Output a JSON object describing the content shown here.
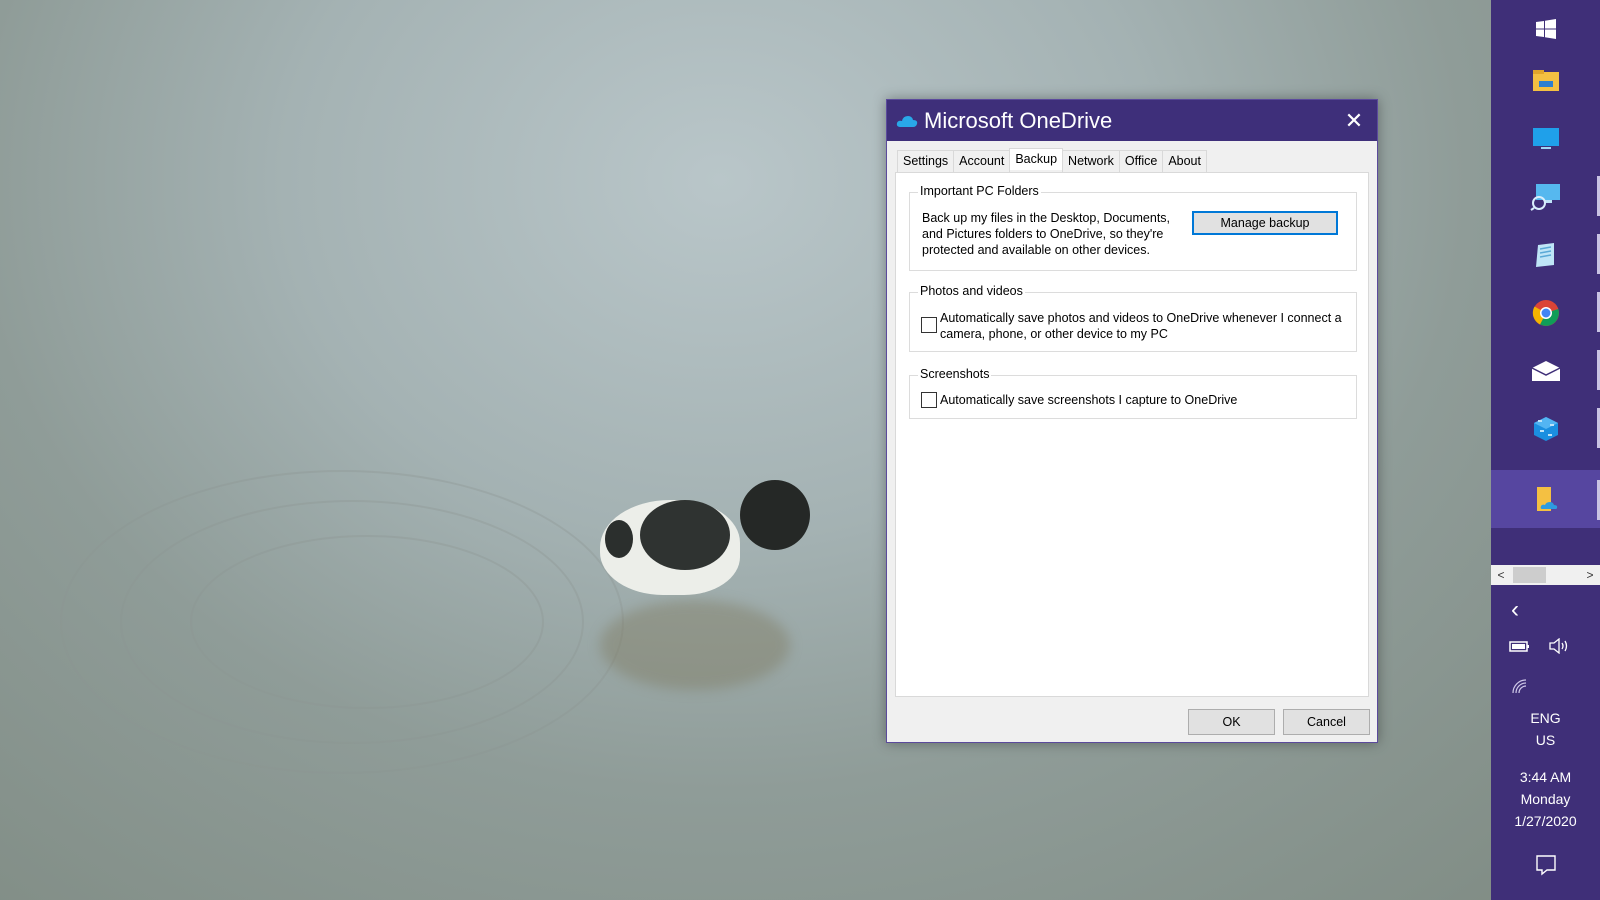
{
  "dialog": {
    "title": "Microsoft OneDrive",
    "close_glyph": "✕",
    "tabs": [
      {
        "label": "Settings"
      },
      {
        "label": "Account"
      },
      {
        "label": "Backup",
        "active": true
      },
      {
        "label": "Network"
      },
      {
        "label": "Office"
      },
      {
        "label": "About"
      }
    ],
    "important_folders": {
      "title": "Important PC Folders",
      "description": "Back up my files in the Desktop, Documents, and Pictures folders to OneDrive, so they're protected and available on other devices.",
      "button_label": "Manage backup"
    },
    "photos_videos": {
      "title": "Photos and videos",
      "checkbox_label": "Automatically save photos and videos to OneDrive whenever I connect a camera, phone, or other device to my PC",
      "checked": false
    },
    "screenshots": {
      "title": "Screenshots",
      "checkbox_label": "Automatically save screenshots I capture to OneDrive",
      "checked": false
    },
    "ok_label": "OK",
    "cancel_label": "Cancel"
  },
  "taskbar": {
    "apps": [
      {
        "icon": "windows-start-icon"
      },
      {
        "icon": "file-explorer-icon"
      },
      {
        "icon": "desktop-monitor-icon"
      },
      {
        "icon": "remote-desktop-search-icon"
      },
      {
        "icon": "notepad-tablet-icon"
      },
      {
        "icon": "chrome-icon"
      },
      {
        "icon": "mail-icon"
      },
      {
        "icon": "blue-cube-app-icon"
      },
      {
        "icon": "onedrive-folder-icon",
        "active": true
      }
    ],
    "chevron_glyph": "‹",
    "language": "ENG",
    "region": "US",
    "time": "3:44 AM",
    "day": "Monday",
    "date": "1/27/2020"
  },
  "colors": {
    "titlebar": "#3e2f7a",
    "taskbar": "#3f2f78",
    "accent_focus": "#0078d7"
  }
}
